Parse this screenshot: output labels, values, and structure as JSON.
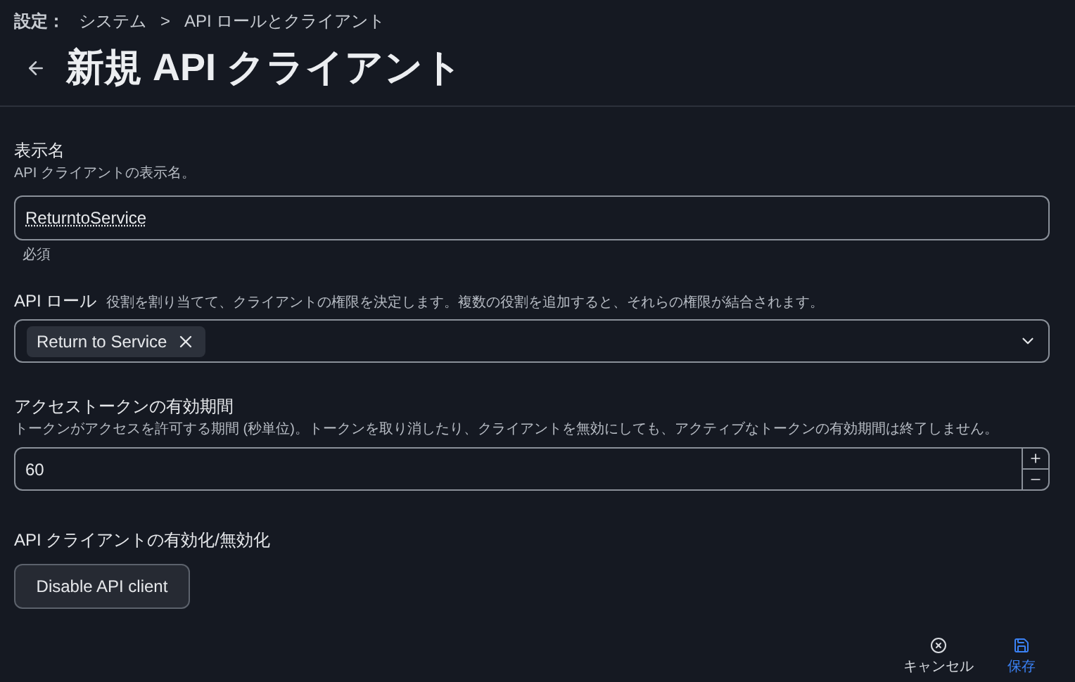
{
  "breadcrumb": [
    {
      "label": "設定："
    },
    {
      "label": "システム"
    },
    {
      "label": "API ロールとクライアント"
    }
  ],
  "breadcrumb_separator": ">",
  "title": "新規 API クライアント",
  "display_name": {
    "label": "表示名",
    "hint": "API クライアントの表示名。",
    "value": "ReturntoService",
    "helper": "必須"
  },
  "api_role": {
    "label": "API ロール",
    "hint": "役割を割り当てて、クライアントの権限を決定します。複数の役割を追加すると、それらの権限が結合されます。",
    "chips": [
      "Return to Service"
    ]
  },
  "token_lifetime": {
    "label": "アクセストークンの有効期間",
    "hint": "トークンがアクセスを許可する期間 (秒単位)。トークンを取り消したり、クライアントを無効にしても、アクティブなトークンの有効期間は終了しません。",
    "value": "60"
  },
  "enable_section": {
    "label": "API クライアントの有効化/無効化",
    "button": "Disable API client"
  },
  "actions": [
    {
      "kind": "cancel",
      "label": "キャンセル"
    },
    {
      "kind": "save",
      "label": "保存"
    }
  ]
}
